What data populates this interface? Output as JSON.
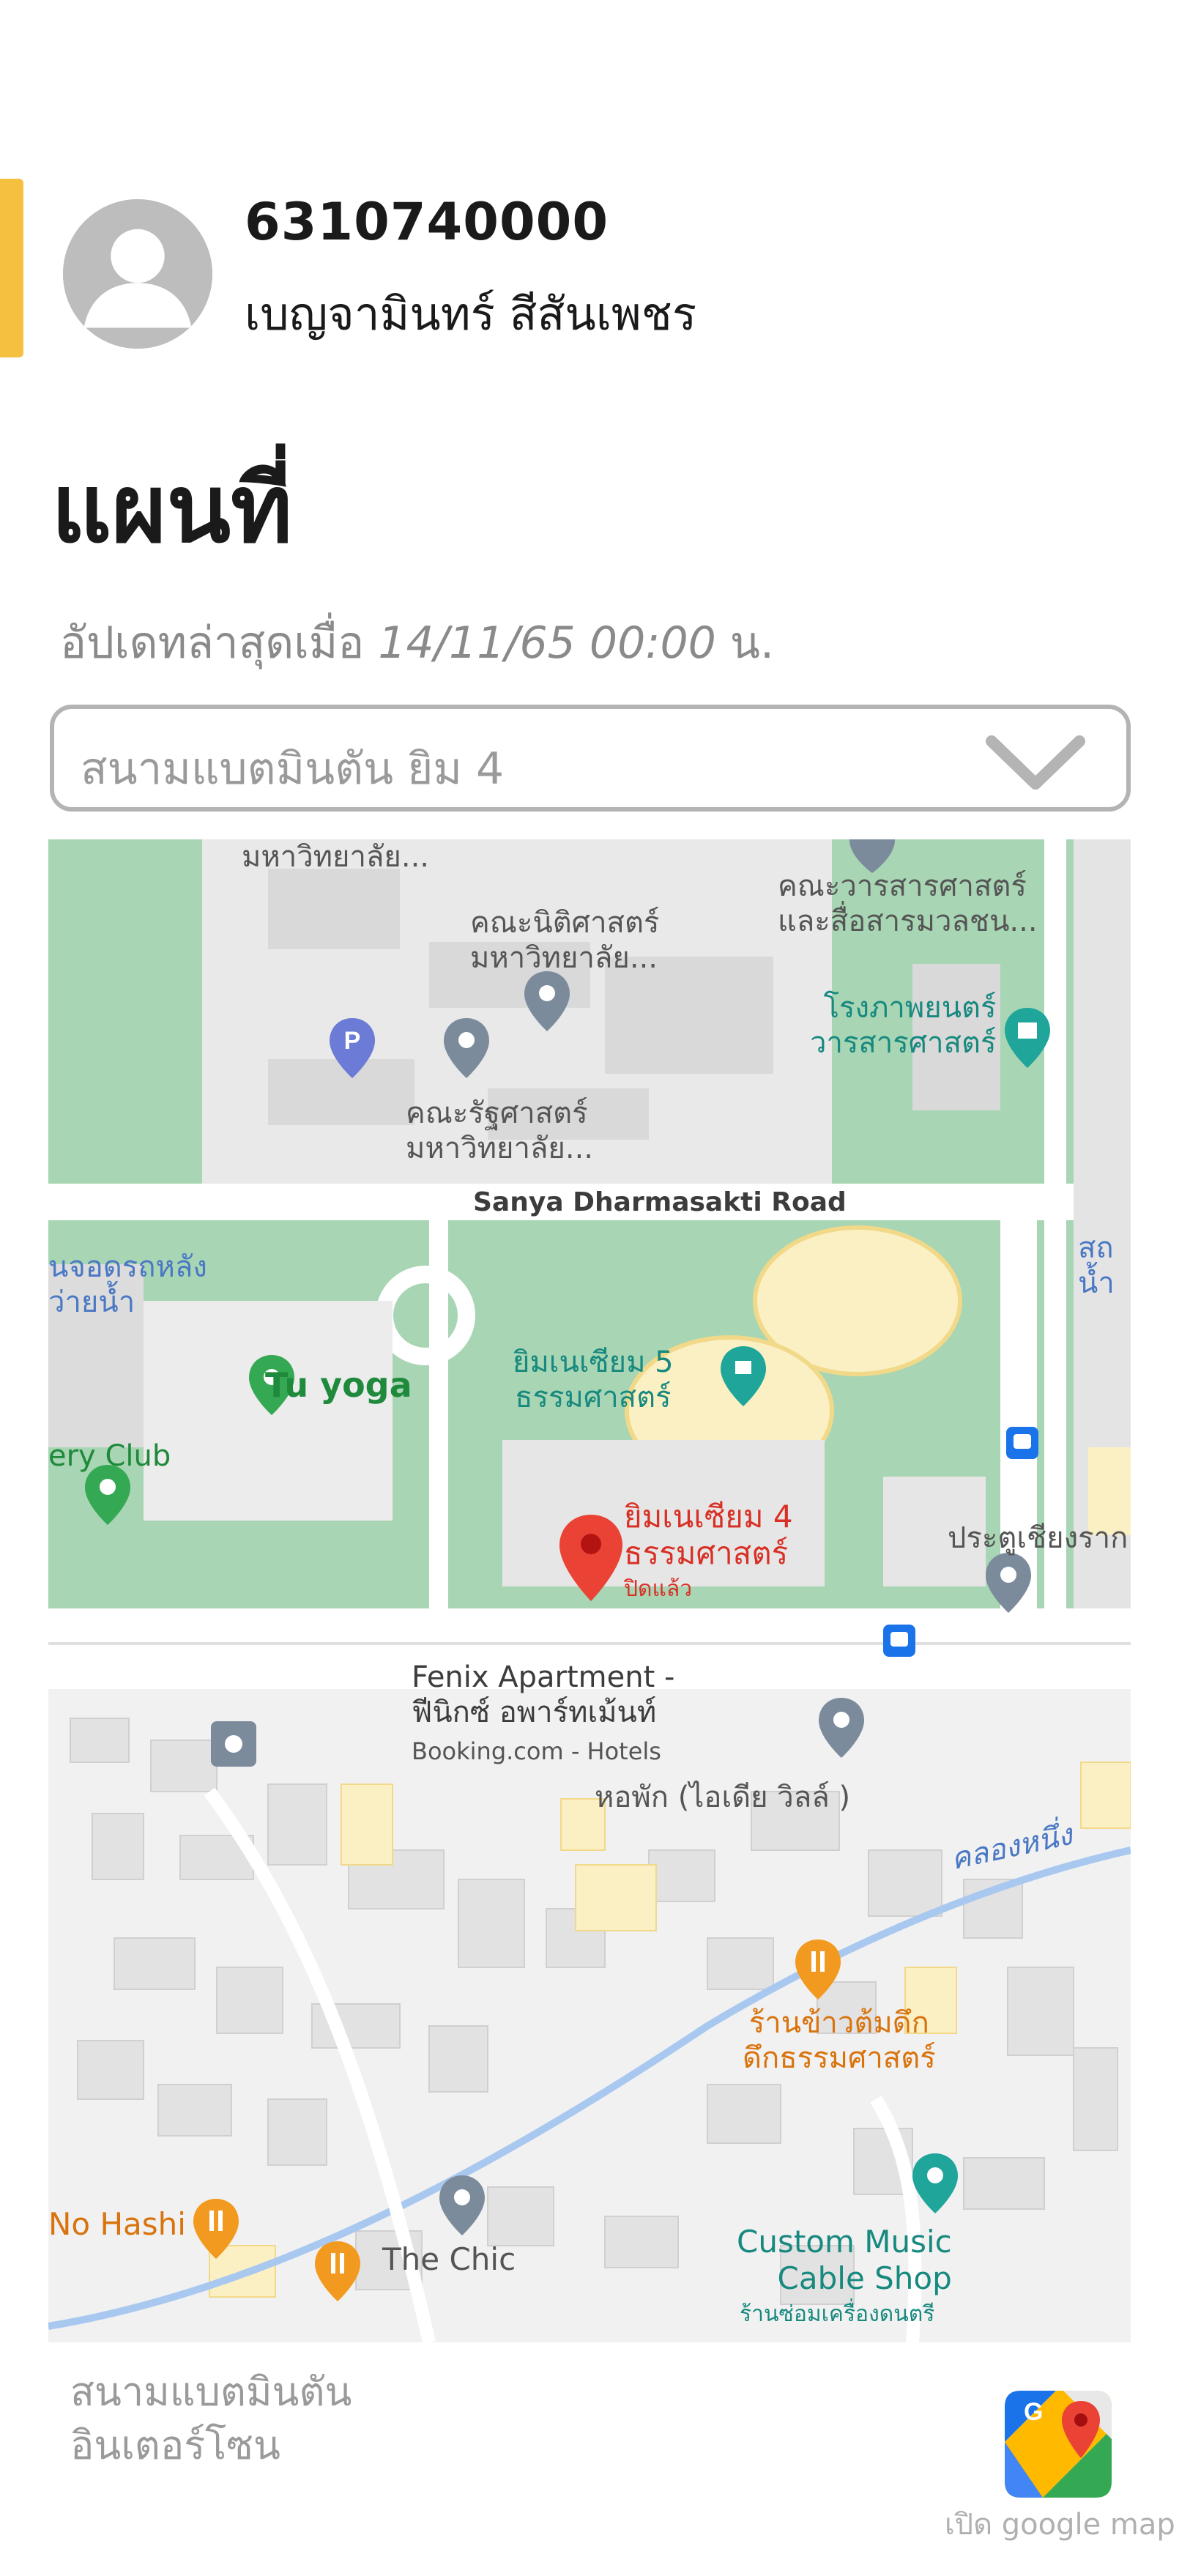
{
  "user": {
    "student_id": "6310740000",
    "name": "เบญจามินทร์ สีสันเพชร"
  },
  "page": {
    "title": "แผนที่",
    "updated_prefix": "อัปเดทล่าสุดเมื่อ",
    "updated_time": "14/11/65 00:00",
    "updated_suffix": "น."
  },
  "selector": {
    "value": "สนามแบตมินตัน ยิม 4",
    "icon": "chevron-down-icon"
  },
  "map": {
    "labels": {
      "mahawittayalai_top": "มหาวิทยาลัย...",
      "law_faculty": "คณะนิติศาสตร์\nมหาวิทยาลัย...",
      "journalism_faculty": "คณะวารสารศาสตร์\nและสื่อสารมวลชน...",
      "cinema": "โรงภาพยนตร์\nวารสารศาสตร์",
      "political_faculty": "คณะรัฐศาสตร์\nมหาวิทยาลัย...",
      "road": "Sanya Dharmasakti Road",
      "parking_left": "นจอดรถหลัง\nว่ายน้ำ",
      "right_edge_top": "สถ\nน้ำ",
      "gym5": "ยิมเนเซียม 5\nธรรมศาสตร์",
      "tu_yoga": "Tu yoga",
      "ery_club": "ery Club",
      "gym4": "ยิมเนเซียม 4\nธรรมศาสตร์",
      "gym4_status": "ปิดแล้ว",
      "gate": "ประตูเชียงราก",
      "fenix": "Fenix Apartment -\nฟีนิกซ์ อพาร์ทเม้นท์",
      "fenix_sub": "Booking.com - Hotels",
      "dorm": "หอพัก (ไอเดีย วิลล์ )",
      "canal": "คลองหนึ่ง",
      "restaurant": "ร้านข้าวต้มดึก\nดึกธรรมศาสตร์",
      "no_hashi": "No Hashi",
      "the_chic": "The Chic",
      "custom_music": "Custom Music\nCable Shop",
      "custom_music_sub": "ร้านซ่อมเครื่องดนตรี"
    },
    "colors": {
      "green": "#a8d5b4",
      "building": "#e8e8e8",
      "road": "#ffffff",
      "water": "#a8c8f0",
      "sand": "#fbf0c4",
      "pin_red": "#ea4335"
    }
  },
  "footer": {
    "venue_name": "สนามแบตมินตัน\nอินเตอร์โซน",
    "open_map_label": "เปิด google map",
    "icon": "google-maps-icon"
  }
}
